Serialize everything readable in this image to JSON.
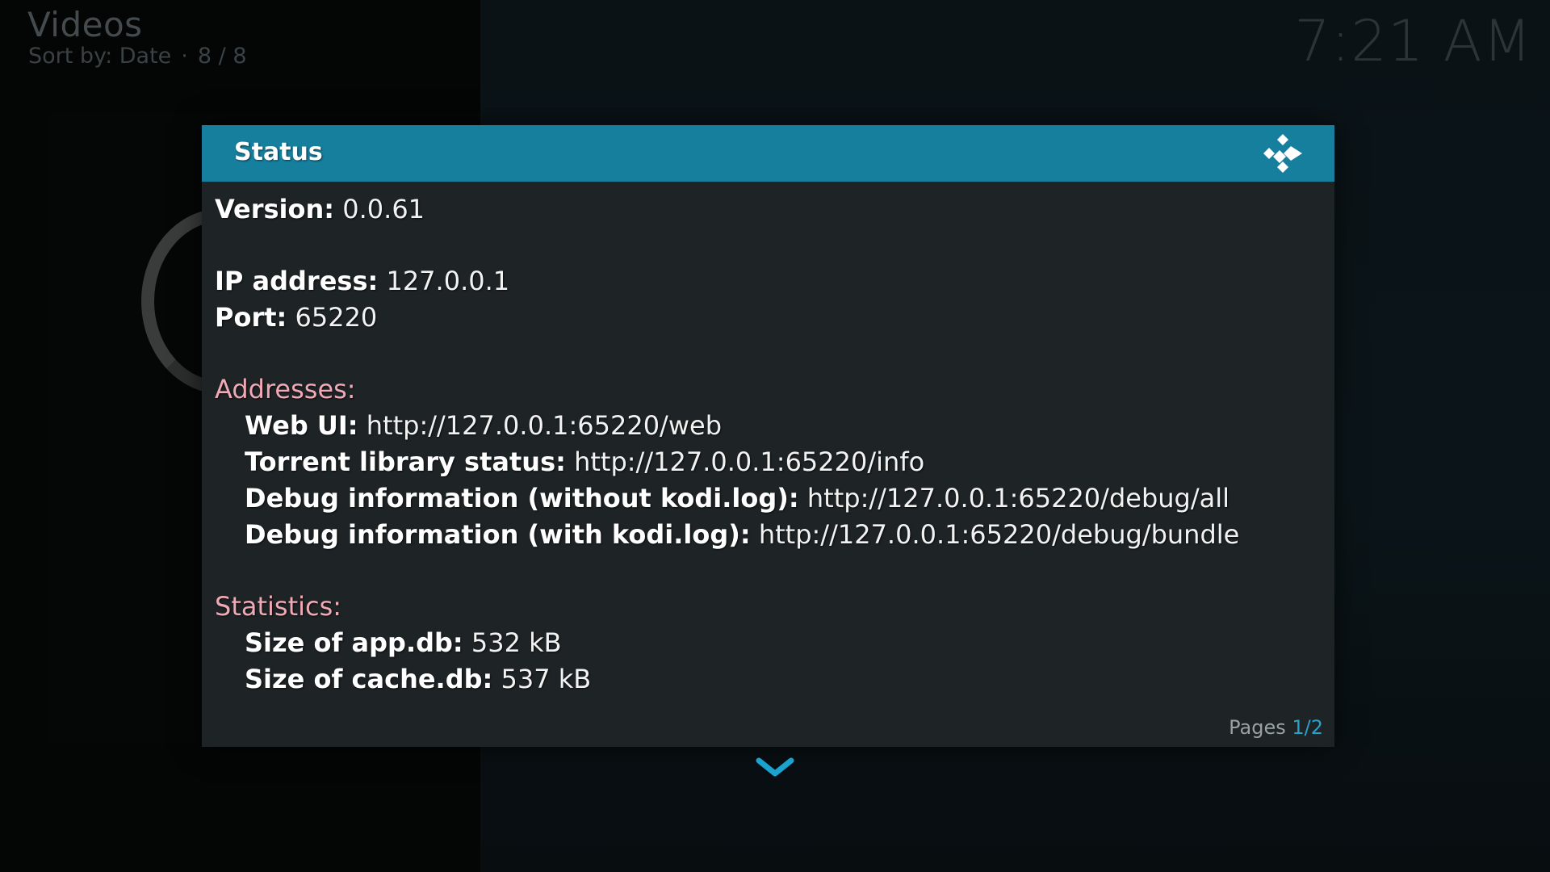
{
  "header": {
    "title": "Videos",
    "sort_label": "Sort by: Date",
    "separator": "·",
    "count": "8 / 8"
  },
  "clock": "7:21 AM",
  "dialog": {
    "title": "Status",
    "logo_icon": "kodi-logo-icon",
    "version": {
      "label": "Version:",
      "value": "0.0.61"
    },
    "ip": {
      "label": "IP address:",
      "value": "127.0.0.1"
    },
    "port": {
      "label": "Port:",
      "value": "65220"
    },
    "addresses": {
      "heading": "Addresses:",
      "items": [
        {
          "label": "Web UI:",
          "value": "http://127.0.0.1:65220/web"
        },
        {
          "label": "Torrent library status:",
          "value": "http://127.0.0.1:65220/info"
        },
        {
          "label": "Debug information (without kodi.log):",
          "value": "http://127.0.0.1:65220/debug/all"
        },
        {
          "label": "Debug information (with kodi.log):",
          "value": "http://127.0.0.1:65220/debug/bundle"
        }
      ]
    },
    "statistics": {
      "heading": "Statistics:",
      "items": [
        {
          "label": "Size of app.db:",
          "value": "532 kB"
        },
        {
          "label": "Size of cache.db:",
          "value": "537 kB"
        }
      ]
    },
    "pages": {
      "label": "Pages",
      "value": "1/2"
    }
  },
  "scroll_icon": "chevron-down-icon",
  "colors": {
    "accent": "#167f9e",
    "section_heading": "#f0a9b6",
    "page_number": "#2aa0c8",
    "dialog_bg": "#1e2426"
  }
}
